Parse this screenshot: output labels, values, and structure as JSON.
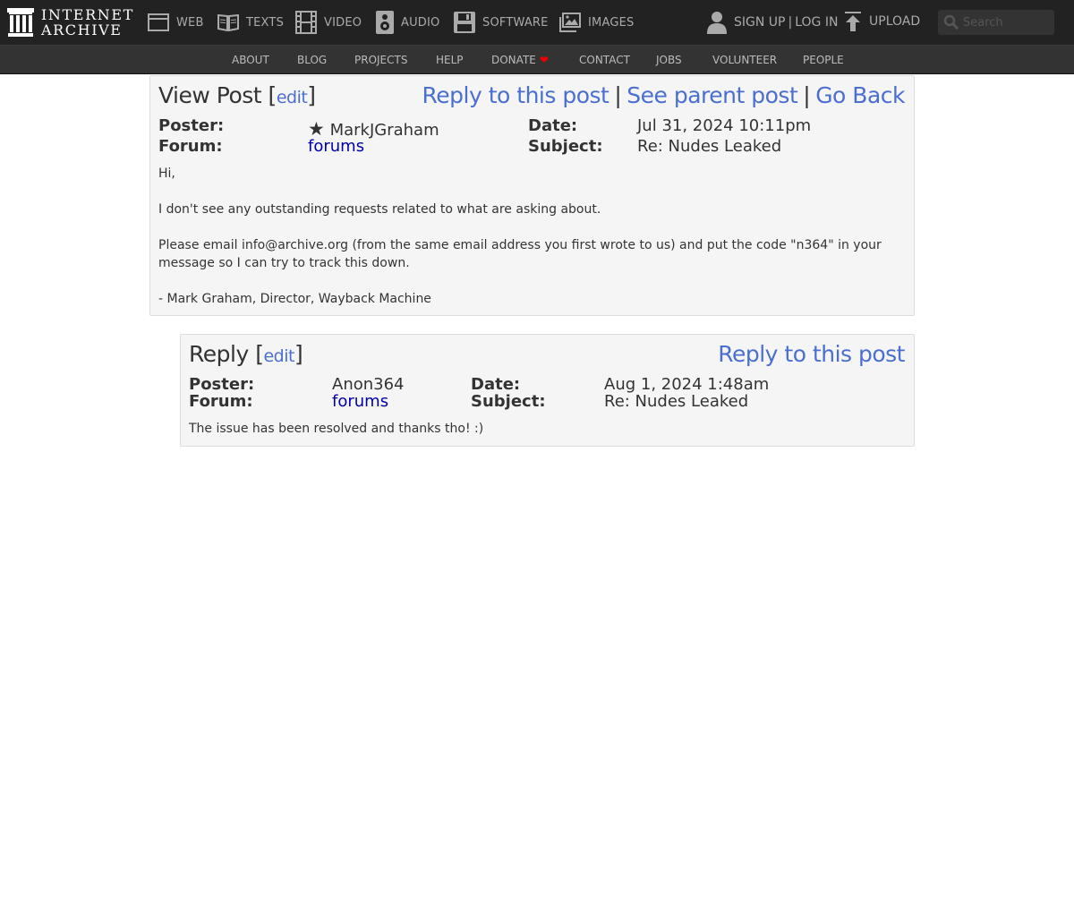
{
  "brand": {
    "line1": "INTERNET",
    "line2": "ARCHIVE"
  },
  "media_nav": [
    {
      "label": "WEB",
      "icon": "web-icon"
    },
    {
      "label": "TEXTS",
      "icon": "book-icon"
    },
    {
      "label": "VIDEO",
      "icon": "film-icon"
    },
    {
      "label": "AUDIO",
      "icon": "speaker-icon"
    },
    {
      "label": "SOFTWARE",
      "icon": "floppy-disk-icon"
    },
    {
      "label": "IMAGES",
      "icon": "image-icon"
    }
  ],
  "account": {
    "signup": "SIGN UP",
    "separator": "|",
    "login": "LOG IN",
    "icon": "user-icon"
  },
  "upload": {
    "label": "UPLOAD",
    "icon": "upload-arrow-icon"
  },
  "search": {
    "placeholder": "Search",
    "icon": "search-icon"
  },
  "sub_nav": [
    "ABOUT",
    "BLOG",
    "PROJECTS",
    "HELP",
    "DONATE",
    "CONTACT",
    "JOBS",
    "VOLUNTEER",
    "PEOPLE"
  ],
  "donate_icon": "heart-icon",
  "post": {
    "title": "View Post",
    "edit": "edit",
    "actions": [
      "Reply to this post",
      "See parent post",
      "Go Back"
    ],
    "poster_label": "Poster:",
    "poster_star": "★",
    "poster": "MarkJGraham",
    "forum_label": "Forum:",
    "forum": "forums",
    "date_label": "Date:",
    "date": "Jul 31, 2024 10:11pm",
    "subject_label": "Subject:",
    "subject": "Re: Nudes Leaked",
    "body": [
      "Hi,",
      "",
      "I don't see any outstanding requests related to what are asking about.",
      "",
      "Please email info@archive.org (from the same email address you first wrote to us) and put the code \"n364\" in your message so I can try to track this down.",
      "",
      "- Mark Graham, Director, Wayback Machine"
    ]
  },
  "reply": {
    "title": "Reply",
    "edit": "edit",
    "action": "Reply to this post",
    "poster_label": "Poster:",
    "poster": "Anon364",
    "forum_label": "Forum:",
    "forum": "forums",
    "date_label": "Date:",
    "date": "Aug 1, 2024 1:48am",
    "subject_label": "Subject:",
    "subject": "Re: Nudes Leaked",
    "body": "The issue has been resolved and thanks tho! :)"
  }
}
